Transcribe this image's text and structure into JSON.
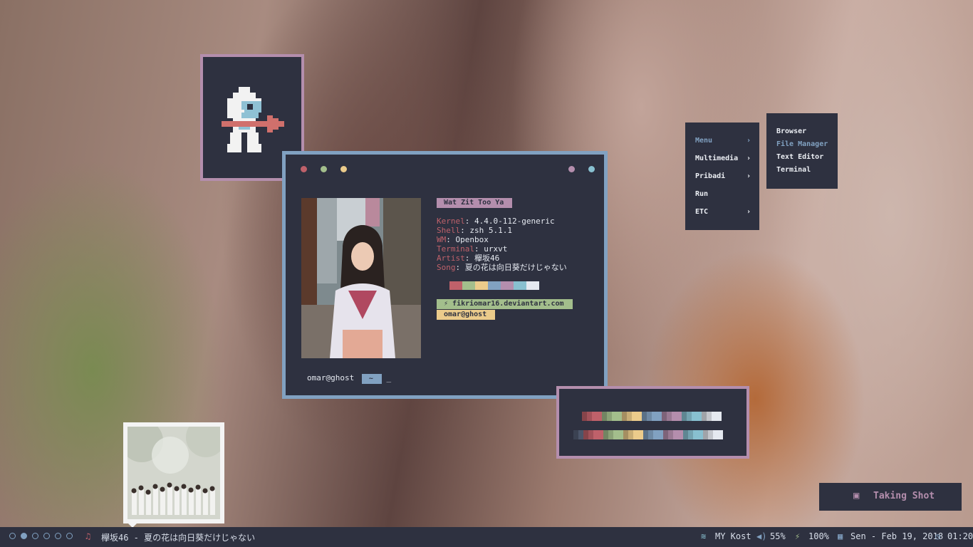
{
  "colors": {
    "panel": "#2e3140",
    "accent_blue": "#81a1c1",
    "accent_pink": "#b48ead",
    "red": "#bf616a",
    "green": "#a3be8c",
    "yellow": "#ebcb8b",
    "cyan": "#88c0d0",
    "fg": "#e5e9f0"
  },
  "terminal": {
    "header_tag": "Wat Zit Too Ya",
    "info": [
      {
        "key": "Kernel",
        "sep": ": ",
        "value": "4.4.0-112-generic"
      },
      {
        "key": "Shell",
        "sep": ": ",
        "value": "zsh 5.1.1"
      },
      {
        "key": "WM",
        "sep": ": ",
        "value": "Openbox"
      },
      {
        "key": "Terminal",
        "sep": ": ",
        "value": "urxvt"
      },
      {
        "key": "Artist",
        "sep": ": ",
        "value": "欅坂46"
      },
      {
        "key": "Song",
        "sep": ": ",
        "value": "夏の花は向日葵だけじゃない"
      }
    ],
    "site_tag": "fikriomar16.deviantart.com",
    "user_tag": "omar@ghost",
    "prompt_user": "omar@ghost",
    "prompt_dir": "~",
    "cursor": "_",
    "swatches": [
      "#bf616a",
      "#a3be8c",
      "#ebcb8b",
      "#81a1c1",
      "#b48ead",
      "#88c0d0",
      "#e5e9f0"
    ]
  },
  "menu": {
    "items": [
      {
        "label": "Menu",
        "arrow": "›",
        "active": true
      },
      {
        "label": "Multimedia",
        "arrow": "›"
      },
      {
        "label": "Pribadi",
        "arrow": "›"
      },
      {
        "label": "Run",
        "arrow": ""
      },
      {
        "label": "ETC",
        "arrow": "›"
      }
    ],
    "submenu": [
      {
        "label": "Browser"
      },
      {
        "label": "File Manager",
        "active": true
      },
      {
        "label": "Text Editor"
      },
      {
        "label": "Terminal"
      }
    ]
  },
  "notification": {
    "icon": "camera-icon",
    "text": "Taking Shot"
  },
  "bar": {
    "workspaces": [
      false,
      true,
      false,
      false,
      false,
      false
    ],
    "music_icon": "music-note-icon",
    "now_playing": "欅坂46 - 夏の花は向日葵だけじゃない",
    "wifi_label": "MY Kost",
    "volume_label": "55%",
    "battery_label": "100%",
    "date_label": "Sen - Feb 19, 2018",
    "time_label": "01:20"
  }
}
